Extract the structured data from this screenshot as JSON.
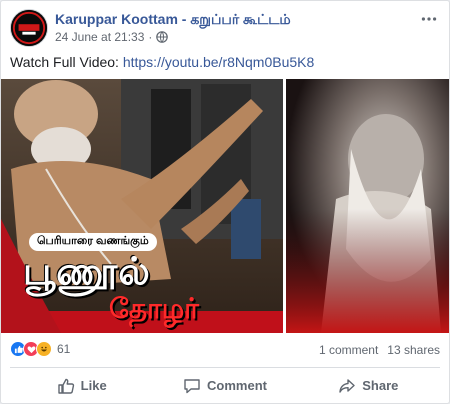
{
  "post": {
    "page_name": "Karuppar Koottam - கறுப்பர் கூட்டம்",
    "timestamp": "24 June at 21:33",
    "privacy_icon": "globe-icon",
    "caption_prefix": "Watch Full Video: ",
    "caption_link": "https://youtu.be/r8Nqm0Bu5K8"
  },
  "media": {
    "title_small": "பெரியாரை வணங்கும்",
    "title_big": "பூணூல்",
    "title_sub": "தோழர்"
  },
  "reactions": {
    "icons": [
      "like-icon",
      "love-icon",
      "haha-icon"
    ],
    "count": "61",
    "comments": "1 comment",
    "shares": "13 shares"
  },
  "actions": {
    "like_label": "Like",
    "comment_label": "Comment",
    "share_label": "Share"
  },
  "colors": {
    "brand_link": "#385898",
    "accent_red": "#ff2a2a"
  }
}
